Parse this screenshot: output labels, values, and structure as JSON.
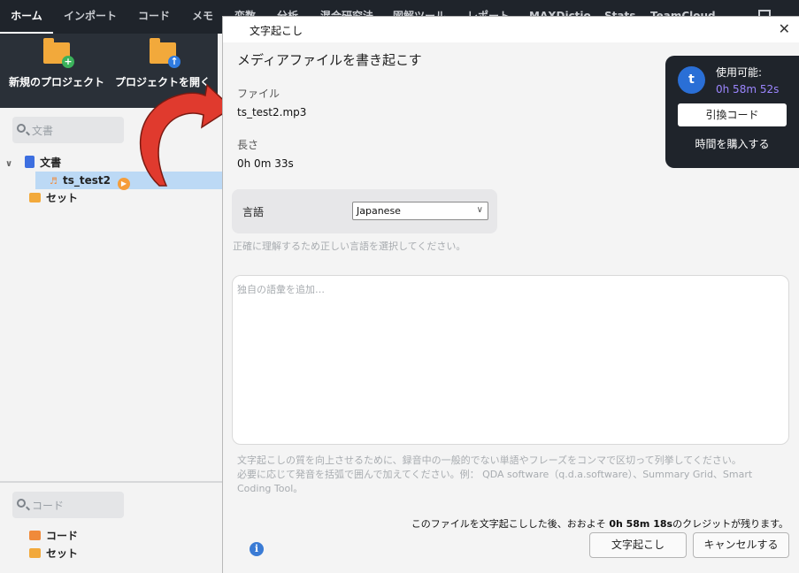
{
  "app": {
    "tabs": [
      "ホーム",
      "インポート",
      "コード",
      "メモ",
      "変数",
      "分析",
      "混合研究法",
      "図解ツール",
      "レポート",
      "MAXDictio",
      "Stats",
      "TeamCloud"
    ],
    "ribbon": {
      "new_project": "新規のプロジェクト",
      "open_project": "プロジェクトを開く"
    },
    "documents_search_placeholder": "文書",
    "codes_search_placeholder": "コード",
    "tree": {
      "documents": "文書",
      "file_item": "ts_test2",
      "sets": "セット"
    },
    "code_tree": {
      "codes": "コード",
      "sets": "セット"
    }
  },
  "dialog": {
    "window_title": "文字起こし",
    "heading": "メディアファイルを書き起こす",
    "file_label": "ファイル",
    "file_value": "ts_test2.mp3",
    "length_label": "長さ",
    "length_value": "0h 0m 33s",
    "language_label": "言語",
    "language_value": "Japanese",
    "language_hint": "正確に理解するため正しい言語を選択してください。",
    "vocab_placeholder": "独自の語彙を追加…",
    "vocab_hint_1": "文字起こしの質を向上させるために、録音中の一般的でない単語やフレーズをコンマで区切って列挙してください。",
    "vocab_hint_2": "必要に応じて発音を括弧で囲んで加えてください。例： QDA software（q.d.a.software）、Summary Grid、Smart",
    "vocab_hint_3": "Coding Tool。",
    "credit_pre": "このファイルを文字起こしした後、おおよそ ",
    "credit_time": "0h 58m 18s",
    "credit_post": "のクレジットが残ります。",
    "transcribe_button": "文字起こし",
    "cancel_button": "キャンセルする"
  },
  "credit_panel": {
    "avatar_letter": "t",
    "available_label": "使用可能:",
    "available_time": "0h 58m 52s",
    "redeem_button": "引換コード",
    "buy_link": "時間を購入する"
  },
  "colors": {
    "accent_purple": "#9c86ff",
    "arrow_red": "#e03a2e",
    "dark_panel": "#1f242b"
  }
}
